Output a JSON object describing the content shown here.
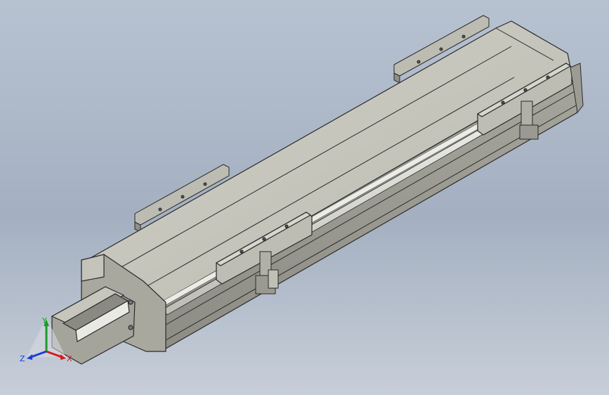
{
  "viewport": {
    "title": "",
    "background_top": "#b7c2d1",
    "background_bottom": "#c7ced8"
  },
  "model": {
    "name": "",
    "body_color": "#c2c2b8",
    "profile_color": "#b9b9b2",
    "outline_color": "#2a2a2a"
  },
  "triad": {
    "x_label": "X",
    "y_label": "Y",
    "z_label": "Z",
    "x_color": "#d51c1c",
    "y_color": "#1c9b2c",
    "z_color": "#1c3ed5"
  }
}
